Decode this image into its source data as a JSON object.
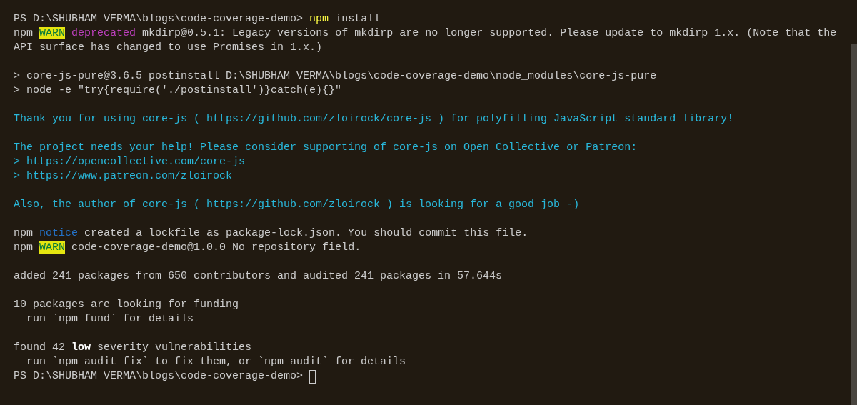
{
  "terminal": {
    "blocks": [
      [
        {
          "segments": [
            {
              "kind": "plain",
              "text": "PS D:\\SHUBHAM VERMA\\blogs\\code-coverage-demo>"
            },
            {
              "kind": "command",
              "text": "npm"
            },
            {
              "kind": "plain",
              "text": "install"
            }
          ]
        },
        {
          "segments": [
            {
              "kind": "plain",
              "text": "npm"
            },
            {
              "kind": "warn",
              "text": "WARN"
            },
            {
              "kind": "deprecated",
              "text": "deprecated"
            },
            {
              "kind": "plain",
              "text": "mkdirp@0.5.1: Legacy versions of mkdirp are no longer supported. Please update to mkdirp 1.x. (Note that the"
            }
          ]
        },
        {
          "segments": [
            {
              "kind": "plain",
              "text": "API surface has changed to use Promises in 1.x.)"
            }
          ]
        }
      ],
      [
        {
          "segments": [
            {
              "kind": "plain",
              "text": "> core-js-pure@3.6.5 postinstall D:\\SHUBHAM VERMA\\blogs\\code-coverage-demo\\node_modules\\core-js-pure"
            }
          ]
        },
        {
          "segments": [
            {
              "kind": "plain",
              "text": "> node -e \"try{require('./postinstall')}catch(e){}\""
            }
          ]
        }
      ],
      [
        {
          "segments": [
            {
              "kind": "info",
              "text": "Thank you for using core-js ( https://github.com/zloirock/core-js ) for polyfilling JavaScript standard library!"
            }
          ]
        }
      ],
      [
        {
          "segments": [
            {
              "kind": "info",
              "text": "The project needs your help! Please consider supporting of core-js on Open Collective or Patreon:"
            }
          ]
        },
        {
          "segments": [
            {
              "kind": "info",
              "text": "> https://opencollective.com/core-js"
            }
          ]
        },
        {
          "segments": [
            {
              "kind": "info",
              "text": "> https://www.patreon.com/zloirock"
            }
          ]
        }
      ],
      [
        {
          "segments": [
            {
              "kind": "info",
              "text": "Also, the author of core-js ( https://github.com/zloirock ) is looking for a good job -)"
            }
          ]
        }
      ],
      [
        {
          "segments": [
            {
              "kind": "plain",
              "text": "npm"
            },
            {
              "kind": "notice",
              "text": "notice"
            },
            {
              "kind": "plain",
              "text": "created a lockfile as package-lock.json. You should commit this file."
            }
          ]
        },
        {
          "segments": [
            {
              "kind": "plain",
              "text": "npm"
            },
            {
              "kind": "warn",
              "text": "WARN"
            },
            {
              "kind": "plain",
              "text": "code-coverage-demo@1.0.0 No repository field."
            }
          ]
        }
      ],
      [
        {
          "segments": [
            {
              "kind": "plain",
              "text": "added 241 packages from 650 contributors and audited 241 packages in 57.644s"
            }
          ]
        }
      ],
      [
        {
          "segments": [
            {
              "kind": "plain",
              "text": "10 packages are looking for funding"
            }
          ]
        },
        {
          "segments": [
            {
              "kind": "plain",
              "text": "  run `npm fund` for details"
            }
          ]
        }
      ],
      [
        {
          "segments": [
            {
              "kind": "plain",
              "text": "found 42"
            },
            {
              "kind": "bold",
              "text": "low"
            },
            {
              "kind": "plain",
              "text": "severity vulnerabilities"
            }
          ]
        },
        {
          "segments": [
            {
              "kind": "plain",
              "text": "  run `npm audit fix` to fix them, or `npm audit` for details"
            }
          ]
        },
        {
          "segments": [
            {
              "kind": "plain",
              "text": "PS D:\\SHUBHAM VERMA\\blogs\\code-coverage-demo>"
            }
          ],
          "cursor": true
        }
      ]
    ]
  }
}
